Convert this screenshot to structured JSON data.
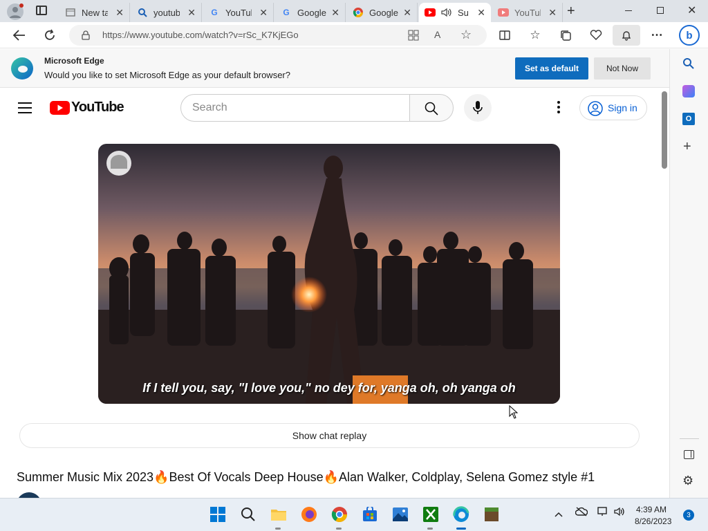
{
  "browser": {
    "tabs": [
      {
        "title": "New ta",
        "favicon": "page-icon"
      },
      {
        "title": "youtub",
        "favicon": "search-icon"
      },
      {
        "title": "YouTub",
        "favicon": "google-icon"
      },
      {
        "title": "Google",
        "favicon": "google-icon"
      },
      {
        "title": "Google",
        "favicon": "chrome-icon"
      },
      {
        "title": "Su",
        "favicon": "youtube-icon"
      },
      {
        "title": "YouTub",
        "favicon": "youtube-icon"
      }
    ],
    "url": "https://www.youtube.com/watch?v=rSc_K7KjEGo"
  },
  "banner": {
    "title": "Microsoft Edge",
    "message": "Would you like to set Microsoft Edge as your default browser?",
    "set_default": "Set as default",
    "not_now": "Not Now"
  },
  "youtube": {
    "logo_text": "YouTube",
    "search_placeholder": "Search",
    "sign_in": "Sign in",
    "caption": "If I tell you, say, \"I love you,\" no dey for, yanga oh, oh yanga oh",
    "chat_replay": "Show chat replay",
    "video_title": "Summer Music Mix 2023🔥Best Of Vocals Deep House🔥Alan Walker, Coldplay, Selena Gomez style #1"
  },
  "taskbar": {
    "time": "4:39 AM",
    "date": "8/26/2023",
    "notifications": "3"
  },
  "colors": {
    "edge_blue": "#0f6cbd",
    "youtube_red": "#ff0000",
    "link_blue": "#065fd4"
  }
}
